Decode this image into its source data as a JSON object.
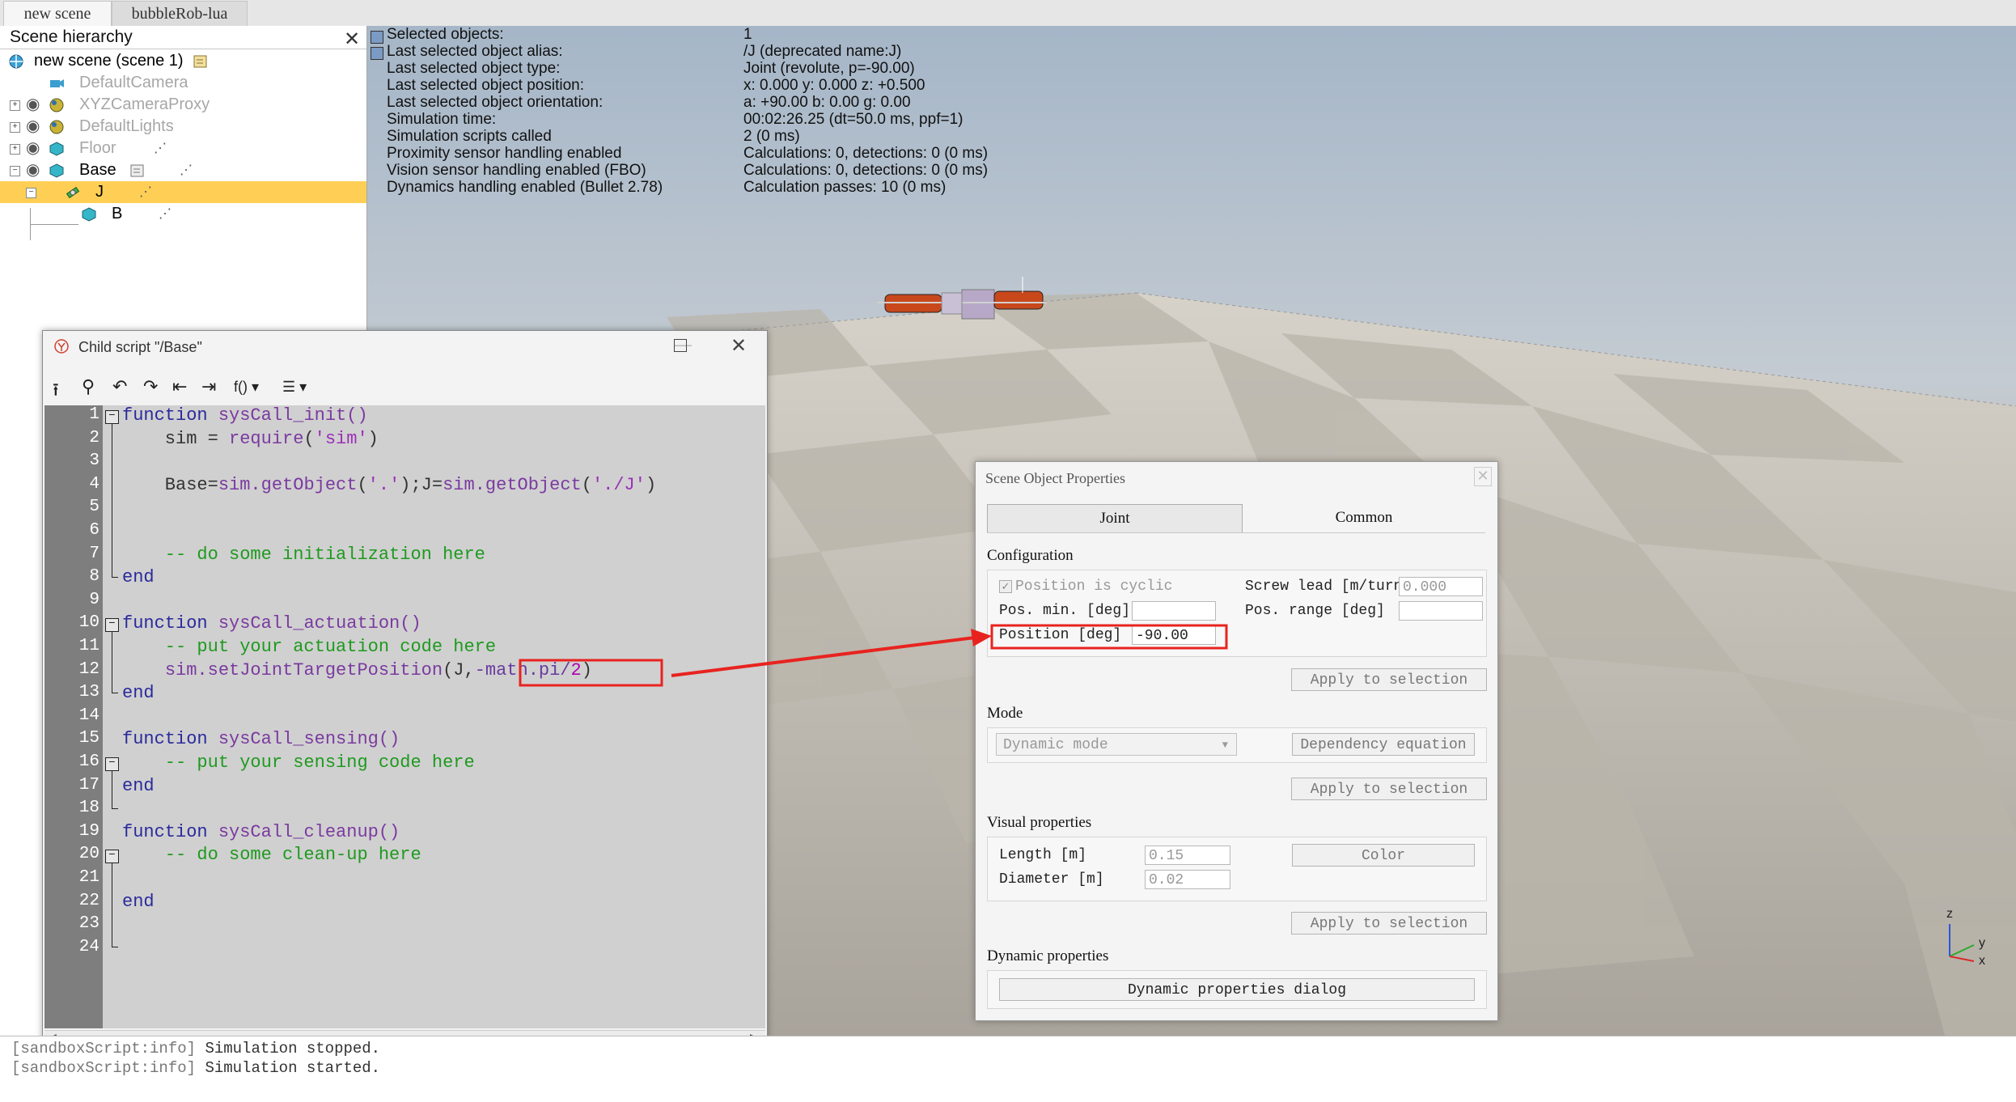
{
  "tabs": [
    {
      "label": "new scene",
      "active": true
    },
    {
      "label": "bubbleRob-lua",
      "active": false
    }
  ],
  "hierarchy": {
    "title": "Scene hierarchy",
    "items": [
      {
        "label": "new scene (scene 1)",
        "icon": "globe-icon"
      },
      {
        "label": "DefaultCamera",
        "icon": "camera-icon"
      },
      {
        "label": "XYZCameraProxy",
        "icon": "sphere-icon"
      },
      {
        "label": "DefaultLights",
        "icon": "sphere-icon"
      },
      {
        "label": "Floor",
        "icon": "cube-icon"
      },
      {
        "label": "Base",
        "icon": "cube-icon"
      },
      {
        "label": "J",
        "icon": "joint-icon",
        "selected": true
      },
      {
        "label": "B",
        "icon": "cube-icon"
      }
    ]
  },
  "info": {
    "rows": [
      {
        "key": "Selected objects:",
        "value": "1"
      },
      {
        "key": "Last selected object alias:",
        "value": "/J    (deprecated name:J)"
      },
      {
        "key": "Last selected object type:",
        "value": "Joint (revolute, p=-90.00)"
      },
      {
        "key": "Last selected object position:",
        "value": "x: 0.000    y: 0.000    z: +0.500"
      },
      {
        "key": "Last selected object orientation:",
        "value": "a: +90.00    b: 0.00    g: 0.00"
      },
      {
        "key": "Simulation time:",
        "value": "00:02:26.25 (dt=50.0 ms, ppf=1)"
      },
      {
        "key": "Simulation scripts called",
        "value": "2 (0 ms)"
      },
      {
        "key": "Proximity sensor handling enabled",
        "value": "Calculations: 0, detections: 0 (0 ms)"
      },
      {
        "key": "Vision sensor handling enabled (FBO)",
        "value": "Calculations: 0, detections: 0 (0 ms)"
      },
      {
        "key": "Dynamics handling enabled (Bullet 2.78)",
        "value": "Calculation passes: 10 (0 ms)"
      }
    ]
  },
  "script_window": {
    "title": "Child script \"/Base\"",
    "line_numbers": [
      "1",
      "2",
      "3",
      "4",
      "5",
      "6",
      "7",
      "8",
      "9",
      "10",
      "11",
      "12",
      "13",
      "14",
      "15",
      "16",
      "17",
      "18",
      "19",
      "20",
      "21",
      "22",
      "23",
      "24"
    ],
    "code": {
      "l1_kw": "function",
      "l1_fn": " sysCall_init()",
      "l2_a": "    sim = ",
      "l2_fn": "require",
      "l2_p1": "(",
      "l2_str": "'sim'",
      "l2_p2": ")",
      "l4_a": "    Base=",
      "l4_fn1": "sim.getObject",
      "l4_p1": "(",
      "l4_str1": "'.'",
      "l4_p2": ");J=",
      "l4_fn2": "sim.getObject",
      "l4_p3": "(",
      "l4_str2": "'./J'",
      "l4_p4": ")",
      "l7": "    -- do some initialization here",
      "l8": "end",
      "l10_kw": "function",
      "l10_fn": " sysCall_actuation()",
      "l11": "    -- put your actuation code here",
      "l12_a": "    ",
      "l12_fn": "sim.setJointTargetPosition",
      "l12_b": "(J,",
      "l12_c": "-math.pi/",
      "l12_num": "2",
      "l12_d": ")",
      "l13": "end",
      "l15_kw": "function",
      "l15_fn": " sysCall_sensing()",
      "l16": "    -- put your sensing code here",
      "l17": "end",
      "l19_kw": "function",
      "l19_fn": " sysCall_cleanup()",
      "l20": "    -- do some clean-up here",
      "l22": "end"
    }
  },
  "console": {
    "lines": [
      {
        "tag": "[sandboxScript:info]",
        "text": " Simulation stopped."
      },
      {
        "tag": "[sandboxScript:info]",
        "text": " Simulation started."
      }
    ]
  },
  "properties": {
    "title": "Scene Object Properties",
    "tabs": [
      "Joint",
      "Common"
    ],
    "configuration_title": "Configuration",
    "position_cyclic": "Position is cyclic",
    "screw_lead_label": "Screw lead [m/turn]",
    "screw_lead_value": "0.000",
    "pos_min_label": "Pos. min. [deg]",
    "pos_min_value": "",
    "pos_range_label": "Pos. range [deg]",
    "pos_range_value": "",
    "position_label": "Position [deg]",
    "position_value": "-90.00",
    "apply_label": "Apply to selection",
    "mode_title": "Mode",
    "mode_value": "Dynamic mode",
    "dependency_label": "Dependency equation",
    "visual_title": "Visual properties",
    "length_label": "Length [m]",
    "length_value": "0.15",
    "diameter_label": "Diameter [m]",
    "diameter_value": "0.02",
    "color_label": "Color",
    "dynamic_title": "Dynamic properties",
    "dynamic_button": "Dynamic properties dialog"
  },
  "axes_labels": {
    "z": "z",
    "y": "y",
    "x": "x"
  },
  "colors": {
    "selection": "#ffcf55",
    "annotation": "#e8231f",
    "gutter": "#7e7e7e",
    "editor_bg": "#d0d0d0"
  }
}
